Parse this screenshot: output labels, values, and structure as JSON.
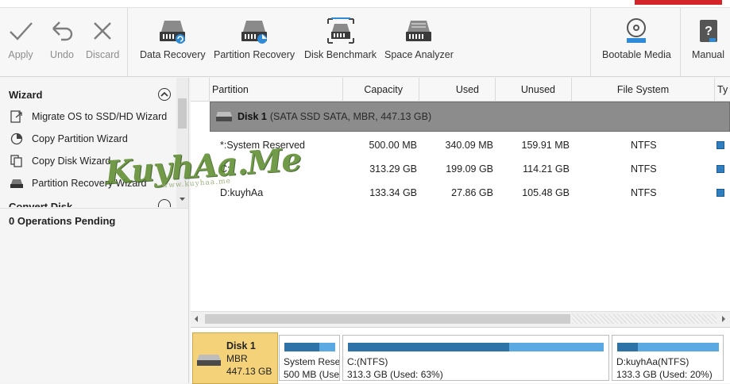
{
  "toolbar": {
    "apply": "Apply",
    "undo": "Undo",
    "discard": "Discard",
    "data_recovery": "Data Recovery",
    "partition_recovery": "Partition Recovery",
    "disk_benchmark": "Disk Benchmark",
    "space_analyzer": "Space Analyzer",
    "bootable_media": "Bootable Media",
    "manual": "Manual"
  },
  "sidebar": {
    "wizard_title": "Wizard",
    "items": [
      {
        "label": "Migrate OS to SSD/HD Wizard",
        "icon": "migrate-icon"
      },
      {
        "label": "Copy Partition Wizard",
        "icon": "copy-partition-icon"
      },
      {
        "label": "Copy Disk Wizard",
        "icon": "copy-disk-icon"
      },
      {
        "label": "Partition Recovery Wizard",
        "icon": "disk-recovery-icon"
      }
    ],
    "next_section": "Convert Disk",
    "operations": "0 Operations Pending"
  },
  "table": {
    "columns": [
      "Partition",
      "Capacity",
      "Used",
      "Unused",
      "File System",
      "Ty"
    ],
    "disk": {
      "name": "Disk 1",
      "detail": "(SATA SSD SATA, MBR, 447.13 GB)"
    },
    "rows": [
      {
        "partition": "*:System Reserved",
        "capacity": "500.00 MB",
        "used": "340.09 MB",
        "unused": "159.91 MB",
        "fs": "NTFS"
      },
      {
        "partition": "C:",
        "capacity": "313.29 GB",
        "used": "199.09 GB",
        "unused": "114.21 GB",
        "fs": "NTFS"
      },
      {
        "partition": "D:kuyhAa",
        "capacity": "133.34 GB",
        "used": "27.86 GB",
        "unused": "105.48 GB",
        "fs": "NTFS"
      }
    ]
  },
  "diskmap": {
    "disk": {
      "name": "Disk 1",
      "type": "MBR",
      "size": "447.13 GB"
    },
    "parts": [
      {
        "name": "System Rese",
        "detail": "500 MB (Use",
        "used_fraction": 0.68
      },
      {
        "name": "C:(NTFS)",
        "detail": "313.3 GB (Used: 63%)",
        "used_fraction": 0.63
      },
      {
        "name": "D:kuyhAa(NTFS)",
        "detail": "133.3 GB (Used: 20%)",
        "used_fraction": 0.2
      }
    ]
  },
  "watermark": {
    "text": "KuyhAa.Me",
    "sub": "www.kuyhaa.me"
  },
  "colors": {
    "accent": "#2e73a8",
    "disk_header": "#8c8c8c",
    "disk_selected": "#f3d27a",
    "brand": "#d4252b"
  }
}
